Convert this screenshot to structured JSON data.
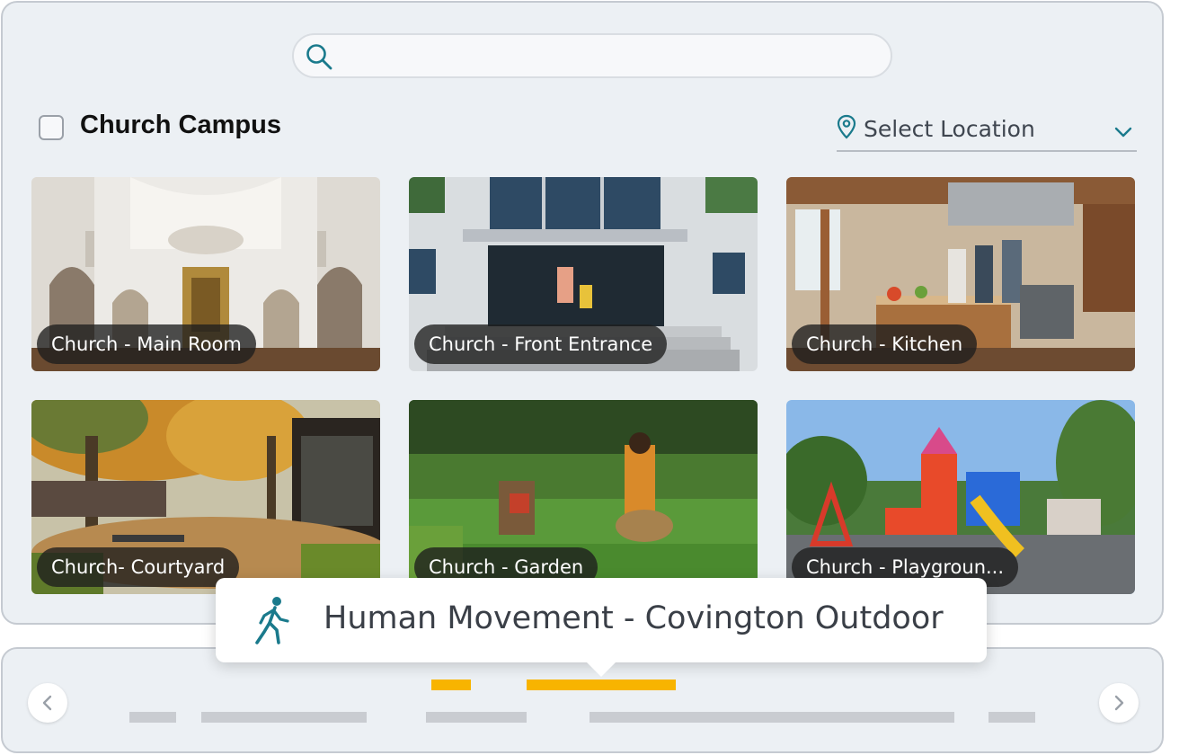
{
  "search": {
    "value": "",
    "placeholder": ""
  },
  "campus": {
    "title": "Church Campus",
    "checked": false
  },
  "location": {
    "label": "Select Location"
  },
  "cards": [
    {
      "label": "Church -  Main Room"
    },
    {
      "label": "Church - Front Entrance"
    },
    {
      "label": "Church - Kitchen"
    },
    {
      "label": "Church- Courtyard"
    },
    {
      "label": "Church - Garden"
    },
    {
      "label": "Church - Playgroun..."
    }
  ],
  "tooltip": {
    "text": "Human Movement  - Covington Outdoor",
    "icon": "walking-person-icon"
  },
  "timeline": {
    "prev_icon": "chevron-left-icon",
    "next_icon": "chevron-right-icon"
  },
  "colors": {
    "accent": "#1a7a8c",
    "event": "#f8b400",
    "track": "#c9ccd1",
    "panel": "#ecf0f4"
  }
}
